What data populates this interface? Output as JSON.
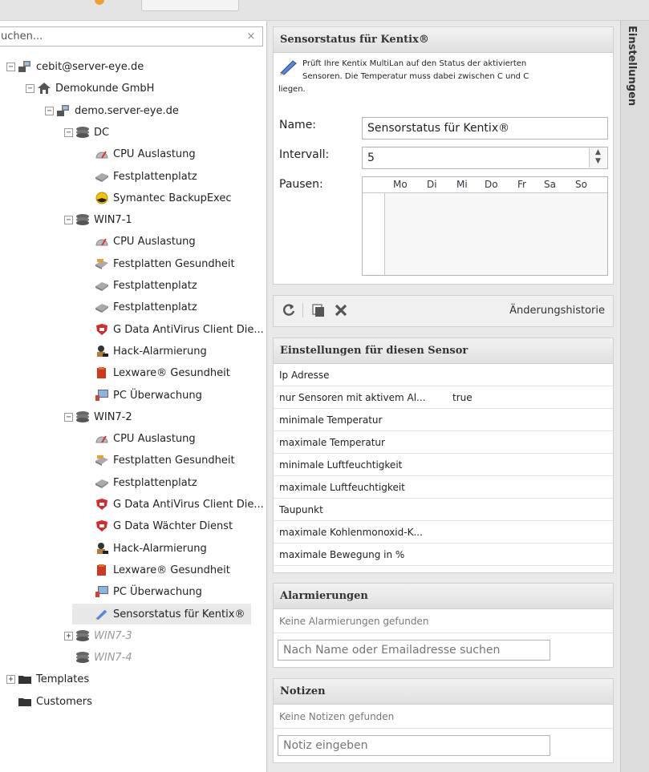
{
  "search": {
    "value": "uchen...",
    "clear": "×"
  },
  "tree": [
    {
      "label": "cebit@server-eye.de",
      "icon": "network-icon",
      "toggle": "−"
    },
    {
      "label": "Demokunde GmbH",
      "icon": "home-icon",
      "toggle": "−"
    },
    {
      "label": "demo.server-eye.de",
      "icon": "network-icon",
      "toggle": "−"
    },
    {
      "label": "DC",
      "icon": "server-stack-icon",
      "toggle": "−"
    },
    {
      "label": "CPU Auslastung",
      "icon": "cpu-gauge-icon"
    },
    {
      "label": "Festplattenplatz",
      "icon": "disk-icon"
    },
    {
      "label": "Symantec BackupExec",
      "icon": "backup-icon"
    },
    {
      "label": "WIN7-1",
      "icon": "server-stack-icon",
      "toggle": "−"
    },
    {
      "label": "CPU Auslastung",
      "icon": "cpu-gauge-icon"
    },
    {
      "label": "Festplatten Gesundheit",
      "icon": "disk-health-icon"
    },
    {
      "label": "Festplattenplatz",
      "icon": "disk-icon"
    },
    {
      "label": "Festplattenplatz",
      "icon": "disk-icon"
    },
    {
      "label": "G Data AntiVirus Client Die...",
      "icon": "gdata-shield-icon"
    },
    {
      "label": "Hack-Alarmierung",
      "icon": "hacker-icon"
    },
    {
      "label": "Lexware® Gesundheit",
      "icon": "lexware-icon"
    },
    {
      "label": "PC Überwachung",
      "icon": "pc-monitor-icon"
    },
    {
      "label": "WIN7-2",
      "icon": "server-stack-icon",
      "toggle": "−"
    },
    {
      "label": "CPU Auslastung",
      "icon": "cpu-gauge-icon"
    },
    {
      "label": "Festplatten Gesundheit",
      "icon": "disk-health-icon"
    },
    {
      "label": "Festplattenplatz",
      "icon": "disk-icon"
    },
    {
      "label": "G Data AntiVirus Client Die...",
      "icon": "gdata-shield-icon"
    },
    {
      "label": "G Data Wächter Dienst",
      "icon": "gdata-shield-icon"
    },
    {
      "label": "Hack-Alarmierung",
      "icon": "hacker-icon"
    },
    {
      "label": "Lexware® Gesundheit",
      "icon": "lexware-icon"
    },
    {
      "label": "PC Überwachung",
      "icon": "pc-monitor-icon"
    },
    {
      "label": "Sensorstatus für Kentix®",
      "icon": "pen-icon",
      "selected": true
    },
    {
      "label": "WIN7-3",
      "icon": "server-stack-icon",
      "toggle": "+",
      "dim": true
    },
    {
      "label": "WIN7-4",
      "icon": "server-stack-icon",
      "dim": true
    },
    {
      "label": "Templates",
      "icon": "folder-icon",
      "toggle": "+"
    },
    {
      "label": "Customers",
      "icon": "folder-icon"
    }
  ],
  "sensor": {
    "title": "Sensorstatus für Kentix®",
    "desc_line1": "Prüft Ihre Kentix MultiLan auf den Status der aktivierten",
    "desc_line2": "Sensoren. Die Temperatur muss dabei zwischen C und C",
    "desc_line3": "liegen.",
    "name_label": "Name:",
    "name_value": "Sensorstatus für Kentix®",
    "interval_label": "Intervall:",
    "interval_value": "5",
    "pause_label": "Pausen:",
    "days": [
      "Mo",
      "Di",
      "Mi",
      "Do",
      "Fr",
      "Sa",
      "So"
    ]
  },
  "toolbar": {
    "history": "Änderungshistorie"
  },
  "settings": {
    "title": "Einstellungen für diesen Sensor",
    "rows": [
      {
        "key": "Ip Adresse",
        "value": ""
      },
      {
        "key": "nur Sensoren mit aktivem Al...",
        "value": "true"
      },
      {
        "key": "minimale Temperatur",
        "value": ""
      },
      {
        "key": "maximale Temperatur",
        "value": ""
      },
      {
        "key": "minimale Luftfeuchtigkeit",
        "value": ""
      },
      {
        "key": "maximale Luftfeuchtigkeit",
        "value": ""
      },
      {
        "key": "Taupunkt",
        "value": ""
      },
      {
        "key": "maximale Kohlenmonoxid-K...",
        "value": ""
      },
      {
        "key": "maximale Bewegung in %",
        "value": ""
      }
    ]
  },
  "alarms": {
    "title": "Alarmierungen",
    "empty": "Keine Alarmierungen gefunden",
    "placeholder": "Nach Name oder Emailadresse suchen"
  },
  "notes": {
    "title": "Notizen",
    "empty": "Keine Notizen gefunden",
    "placeholder": "Notiz eingeben"
  },
  "side_tab": "Einstellungen"
}
